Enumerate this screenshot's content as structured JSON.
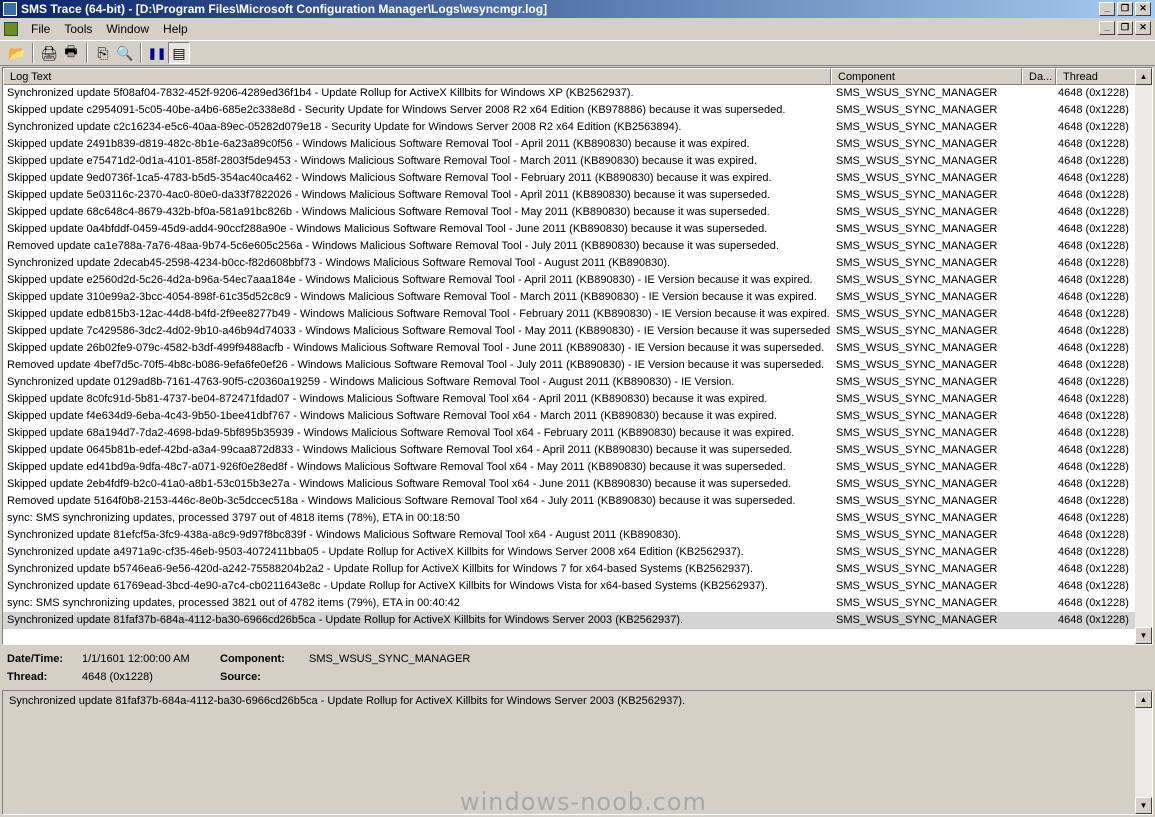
{
  "window": {
    "title": "SMS Trace (64-bit) - [D:\\Program Files\\Microsoft Configuration Manager\\Logs\\wsyncmgr.log]",
    "btn_min": "_",
    "btn_max": "❐",
    "btn_close": "✕"
  },
  "menu": {
    "file": "File",
    "tools": "Tools",
    "window": "Window",
    "help": "Help"
  },
  "toolbar": {
    "open": "📂",
    "print_preview": "🖨",
    "print": "🖶",
    "copy": "⎘",
    "find": "🔍",
    "pause": "❚❚",
    "view": "▤"
  },
  "columns": {
    "log_text": "Log Text",
    "component": "Component",
    "date": "Da...",
    "thread": "Thread"
  },
  "rows": [
    {
      "text": "Synchronized update 5f08af04-7832-452f-9206-4289ed36f1b4 - Update Rollup for ActiveX Killbits for Windows XP (KB2562937).",
      "component": "SMS_WSUS_SYNC_MANAGER",
      "thread": "4648 (0x1228)"
    },
    {
      "text": "Skipped update c2954091-5c05-40be-a4b6-685e2c338e8d - Security Update for Windows Server 2008 R2 x64 Edition (KB978886) because it was superseded.",
      "component": "SMS_WSUS_SYNC_MANAGER",
      "thread": "4648 (0x1228)"
    },
    {
      "text": "Synchronized update c2c16234-e5c6-40aa-89ec-05282d079e18 - Security Update for Windows Server 2008 R2 x64 Edition (KB2563894).",
      "component": "SMS_WSUS_SYNC_MANAGER",
      "thread": "4648 (0x1228)"
    },
    {
      "text": "Skipped update 2491b839-d819-482c-8b1e-6a23a89c0f56 - Windows Malicious Software Removal Tool - April 2011 (KB890830) because it was expired.",
      "component": "SMS_WSUS_SYNC_MANAGER",
      "thread": "4648 (0x1228)"
    },
    {
      "text": "Skipped update e75471d2-0d1a-4101-858f-2803f5de9453 - Windows Malicious Software Removal Tool - March 2011 (KB890830) because it was expired.",
      "component": "SMS_WSUS_SYNC_MANAGER",
      "thread": "4648 (0x1228)"
    },
    {
      "text": "Skipped update 9ed0736f-1ca5-4783-b5d5-354ac40ca462 - Windows Malicious Software Removal Tool - February 2011 (KB890830) because it was expired.",
      "component": "SMS_WSUS_SYNC_MANAGER",
      "thread": "4648 (0x1228)"
    },
    {
      "text": "Skipped update 5e03116c-2370-4ac0-80e0-da33f7822026 - Windows Malicious Software Removal Tool - April 2011 (KB890830) because it was superseded.",
      "component": "SMS_WSUS_SYNC_MANAGER",
      "thread": "4648 (0x1228)"
    },
    {
      "text": "Skipped update 68c648c4-8679-432b-bf0a-581a91bc826b - Windows Malicious Software Removal Tool - May 2011 (KB890830) because it was superseded.",
      "component": "SMS_WSUS_SYNC_MANAGER",
      "thread": "4648 (0x1228)"
    },
    {
      "text": "Skipped update 0a4bfddf-0459-45d9-add4-90ccf288a90e - Windows Malicious Software Removal Tool - June 2011 (KB890830) because it was superseded.",
      "component": "SMS_WSUS_SYNC_MANAGER",
      "thread": "4648 (0x1228)"
    },
    {
      "text": "Removed update ca1e788a-7a76-48aa-9b74-5c6e605c256a - Windows Malicious Software Removal Tool - July 2011 (KB890830) because it was superseded.",
      "component": "SMS_WSUS_SYNC_MANAGER",
      "thread": "4648 (0x1228)"
    },
    {
      "text": "Synchronized update 2decab45-2598-4234-b0cc-f82d608bbf73 - Windows Malicious Software Removal Tool - August 2011 (KB890830).",
      "component": "SMS_WSUS_SYNC_MANAGER",
      "thread": "4648 (0x1228)"
    },
    {
      "text": "Skipped update e2560d2d-5c26-4d2a-b96a-54ec7aaa184e - Windows Malicious Software Removal Tool - April 2011 (KB890830)  - IE Version because it was expired.",
      "component": "SMS_WSUS_SYNC_MANAGER",
      "thread": "4648 (0x1228)"
    },
    {
      "text": "Skipped update 310e99a2-3bcc-4054-898f-61c35d52c8c9 - Windows Malicious Software Removal Tool - March 2011 (KB890830)  - IE Version because it was expired.",
      "component": "SMS_WSUS_SYNC_MANAGER",
      "thread": "4648 (0x1228)"
    },
    {
      "text": "Skipped update edb815b3-12ac-44d8-b4fd-2f9ee8277b49 - Windows Malicious Software Removal Tool - February 2011 (KB890830)  - IE Version because it was expired.",
      "component": "SMS_WSUS_SYNC_MANAGER",
      "thread": "4648 (0x1228)"
    },
    {
      "text": "Skipped update 7c429586-3dc2-4d02-9b10-a46b94d74033 - Windows Malicious Software Removal Tool - May 2011 (KB890830)  - IE Version because it was superseded.",
      "component": "SMS_WSUS_SYNC_MANAGER",
      "thread": "4648 (0x1228)"
    },
    {
      "text": "Skipped update 26b02fe9-079c-4582-b3df-499f9488acfb - Windows Malicious Software Removal Tool - June 2011 (KB890830)  - IE Version because it was superseded.",
      "component": "SMS_WSUS_SYNC_MANAGER",
      "thread": "4648 (0x1228)"
    },
    {
      "text": "Removed update 4bef7d5c-70f5-4b8c-b086-9efa6fe0ef26 - Windows Malicious Software Removal Tool - July 2011 (KB890830)  - IE Version because it was superseded.",
      "component": "SMS_WSUS_SYNC_MANAGER",
      "thread": "4648 (0x1228)"
    },
    {
      "text": "Synchronized update 0129ad8b-7161-4763-90f5-c20360a19259 - Windows Malicious Software Removal Tool - August 2011 (KB890830)  - IE Version.",
      "component": "SMS_WSUS_SYNC_MANAGER",
      "thread": "4648 (0x1228)"
    },
    {
      "text": "Skipped update 8c0fc91d-5b81-4737-be04-872471fdad07 - Windows Malicious Software Removal Tool x64 - April 2011 (KB890830) because it was expired.",
      "component": "SMS_WSUS_SYNC_MANAGER",
      "thread": "4648 (0x1228)"
    },
    {
      "text": "Skipped update f4e634d9-6eba-4c43-9b50-1bee41dbf767 - Windows Malicious Software Removal Tool x64 - March 2011 (KB890830) because it was expired.",
      "component": "SMS_WSUS_SYNC_MANAGER",
      "thread": "4648 (0x1228)"
    },
    {
      "text": "Skipped update 68a194d7-7da2-4698-bda9-5bf895b35939 - Windows Malicious Software Removal Tool x64 - February 2011 (KB890830) because it was expired.",
      "component": "SMS_WSUS_SYNC_MANAGER",
      "thread": "4648 (0x1228)"
    },
    {
      "text": "Skipped update 0645b81b-edef-42bd-a3a4-99caa872d833 - Windows Malicious Software Removal Tool x64 - April 2011 (KB890830) because it was superseded.",
      "component": "SMS_WSUS_SYNC_MANAGER",
      "thread": "4648 (0x1228)"
    },
    {
      "text": "Skipped update ed41bd9a-9dfa-48c7-a071-926f0e28ed8f - Windows Malicious Software Removal Tool x64 - May 2011 (KB890830) because it was superseded.",
      "component": "SMS_WSUS_SYNC_MANAGER",
      "thread": "4648 (0x1228)"
    },
    {
      "text": "Skipped update 2eb4fdf9-b2c0-41a0-a8b1-53c015b3e27a - Windows Malicious Software Removal Tool x64 - June 2011 (KB890830) because it was superseded.",
      "component": "SMS_WSUS_SYNC_MANAGER",
      "thread": "4648 (0x1228)"
    },
    {
      "text": "Removed update 5164f0b8-2153-446c-8e0b-3c5dccec518a - Windows Malicious Software Removal Tool x64 - July 2011 (KB890830) because it was superseded.",
      "component": "SMS_WSUS_SYNC_MANAGER",
      "thread": "4648 (0x1228)"
    },
    {
      "text": "sync: SMS synchronizing updates, processed 3797 out of 4818 items (78%), ETA in 00:18:50",
      "component": "SMS_WSUS_SYNC_MANAGER",
      "thread": "4648 (0x1228)"
    },
    {
      "text": "Synchronized update 81efcf5a-3fc9-438a-a8c9-9d97f8bc839f - Windows Malicious Software Removal Tool x64 - August 2011 (KB890830).",
      "component": "SMS_WSUS_SYNC_MANAGER",
      "thread": "4648 (0x1228)"
    },
    {
      "text": "Synchronized update a4971a9c-cf35-46eb-9503-4072411bba05 - Update Rollup for ActiveX Killbits for Windows Server 2008 x64 Edition (KB2562937).",
      "component": "SMS_WSUS_SYNC_MANAGER",
      "thread": "4648 (0x1228)"
    },
    {
      "text": "Synchronized update b5746ea6-9e56-420d-a242-75588204b2a2 - Update Rollup for ActiveX Killbits for Windows 7 for x64-based Systems (KB2562937).",
      "component": "SMS_WSUS_SYNC_MANAGER",
      "thread": "4648 (0x1228)"
    },
    {
      "text": "Synchronized update 61769ead-3bcd-4e90-a7c4-cb0211643e8c - Update Rollup for ActiveX Killbits for Windows Vista for x64-based Systems (KB2562937).",
      "component": "SMS_WSUS_SYNC_MANAGER",
      "thread": "4648 (0x1228)"
    },
    {
      "text": "sync: SMS synchronizing updates, processed 3821 out of 4782 items (79%), ETA in 00:40:42",
      "component": "SMS_WSUS_SYNC_MANAGER",
      "thread": "4648 (0x1228)"
    },
    {
      "text": "Synchronized update 81faf37b-684a-4112-ba30-6966cd26b5ca - Update Rollup for ActiveX Killbits for Windows Server 2003 (KB2562937).",
      "component": "SMS_WSUS_SYNC_MANAGER",
      "thread": "4648 (0x1228)"
    }
  ],
  "details": {
    "datetime_label": "Date/Time:",
    "datetime_value": "1/1/1601 12:00:00 AM",
    "component_label": "Component:",
    "component_value": "SMS_WSUS_SYNC_MANAGER",
    "thread_label": "Thread:",
    "thread_value": "4648 (0x1228)",
    "source_label": "Source:",
    "source_value": ""
  },
  "message": "Synchronized update 81faf37b-684a-4112-ba30-6966cd26b5ca - Update Rollup for ActiveX Killbits for Windows Server 2003 (KB2562937).",
  "watermark": "windows-noob.com",
  "scroll": {
    "up": "▲",
    "down": "▼"
  }
}
